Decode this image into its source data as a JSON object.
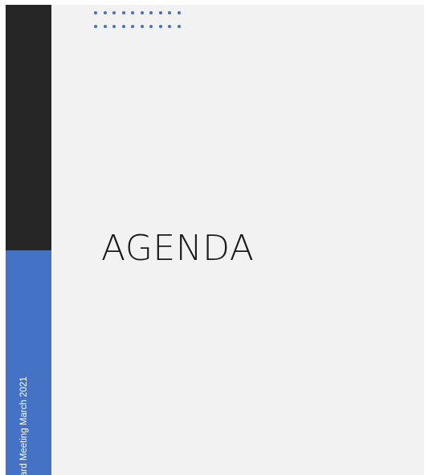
{
  "slide": {
    "title": "AGENDA",
    "side_text": "ard Meeting March 2021"
  },
  "decoration": {
    "dot_rows": 2,
    "dot_columns": 10,
    "accent_color": "#4472c4",
    "dark_bar_color": "#262626",
    "slide_background": "#f2f2f2"
  }
}
